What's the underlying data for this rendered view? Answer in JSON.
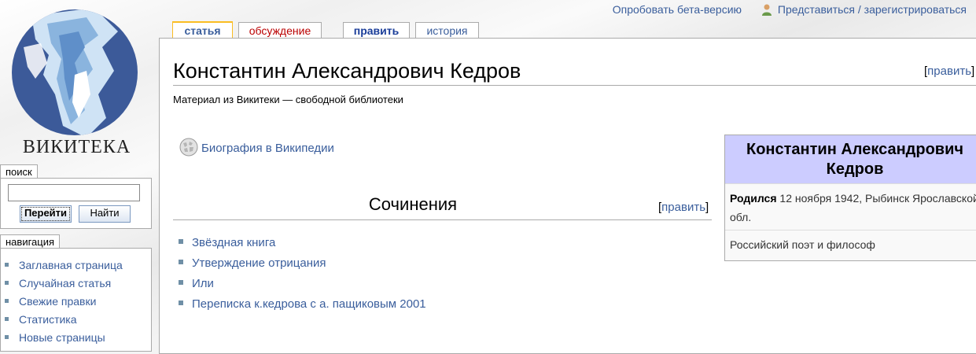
{
  "personal_tools": {
    "beta": "Опробовать бета-версию",
    "login": "Представиться / зарегистрироваться"
  },
  "tabs": [
    {
      "label": "статья"
    },
    {
      "label": "обсуждение"
    },
    {
      "label": "править"
    },
    {
      "label": "история"
    }
  ],
  "logo": {
    "text": "ВИКИТЕКА"
  },
  "search": {
    "header": "поиск",
    "value": "",
    "go_label": "Перейти",
    "search_label": "Найти"
  },
  "navigation": {
    "header": "навигация",
    "items": [
      "Заглавная страница",
      "Случайная статья",
      "Свежие правки",
      "Статистика",
      "Новые страницы"
    ]
  },
  "article": {
    "title": "Константин Александрович Кедров",
    "edit_label": "править",
    "site_sub": "Материал из Викитеки — свободной библиотеки",
    "wikipedia_link": "Биография в Википедии",
    "section_title": "Сочинения",
    "works": [
      "Звёздная книга",
      "Утверждение отрицания",
      "Или",
      "Переписка к.кедрова с а. пащиковым 2001"
    ]
  },
  "infobox": {
    "title": "Константин Александрович Кедров",
    "born_label": "Родился",
    "born_value": "12 ноября 1942, Рыбинск Ярославской обл.",
    "description": "Российский поэт и философ"
  },
  "colors": {
    "link": "#3a5e9c",
    "new_link": "#ba0000",
    "selected_tab_border": "#fabd23",
    "infobox_title_bg": "#ccccff"
  }
}
